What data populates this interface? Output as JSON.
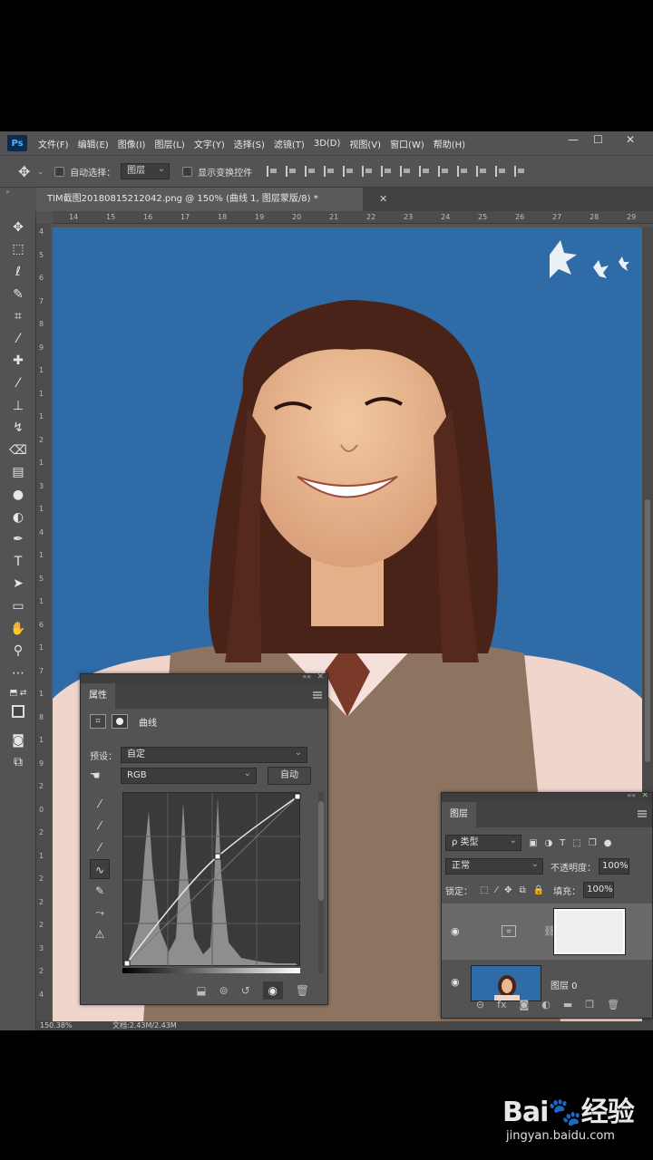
{
  "menubar": {
    "items": [
      "文件(F)",
      "编辑(E)",
      "图像(I)",
      "图层(L)",
      "文字(Y)",
      "选择(S)",
      "滤镜(T)",
      "3D(D)",
      "视图(V)",
      "窗口(W)",
      "帮助(H)"
    ]
  },
  "options": {
    "auto_select_label": "自动选择：",
    "auto_select_value": "图层",
    "show_transform_label": "显示变换控件"
  },
  "document": {
    "tab_title": "TIM截图20180815212042.png @ 150% (曲线 1, 图层蒙版/8) *",
    "ruler_top": [
      "14",
      "15",
      "16",
      "17",
      "18",
      "19",
      "20",
      "21",
      "22",
      "23",
      "24",
      "25",
      "26",
      "27",
      "28",
      "29"
    ],
    "ruler_left": [
      "4",
      "5",
      "6",
      "7",
      "8",
      "9",
      "1",
      "1",
      "1",
      "2",
      "1",
      "3",
      "1",
      "4",
      "1",
      "5",
      "1",
      "6",
      "1",
      "7",
      "1",
      "8",
      "1",
      "9",
      "2",
      "0",
      "2",
      "1",
      "2",
      "2",
      "2",
      "3",
      "2",
      "4"
    ],
    "status_zoom": "150.38%",
    "status_doc": "文档:2.43M/2.43M"
  },
  "properties": {
    "tab": "属性",
    "type_label": "曲线",
    "preset_label": "预设：",
    "preset_value": "自定",
    "channel_value": "RGB",
    "auto_button": "自动"
  },
  "layers": {
    "tab": "图层",
    "filter_value": "ρ 类型",
    "blend_mode": "正常",
    "opacity_label": "不透明度：",
    "opacity_value": "100%",
    "lock_label": "锁定：",
    "fill_label": "填充：",
    "fill_value": "100%",
    "layer0_name": "图层 0"
  },
  "watermark": {
    "logo": "Bai du 经验",
    "url": "jingyan.baidu.com"
  }
}
